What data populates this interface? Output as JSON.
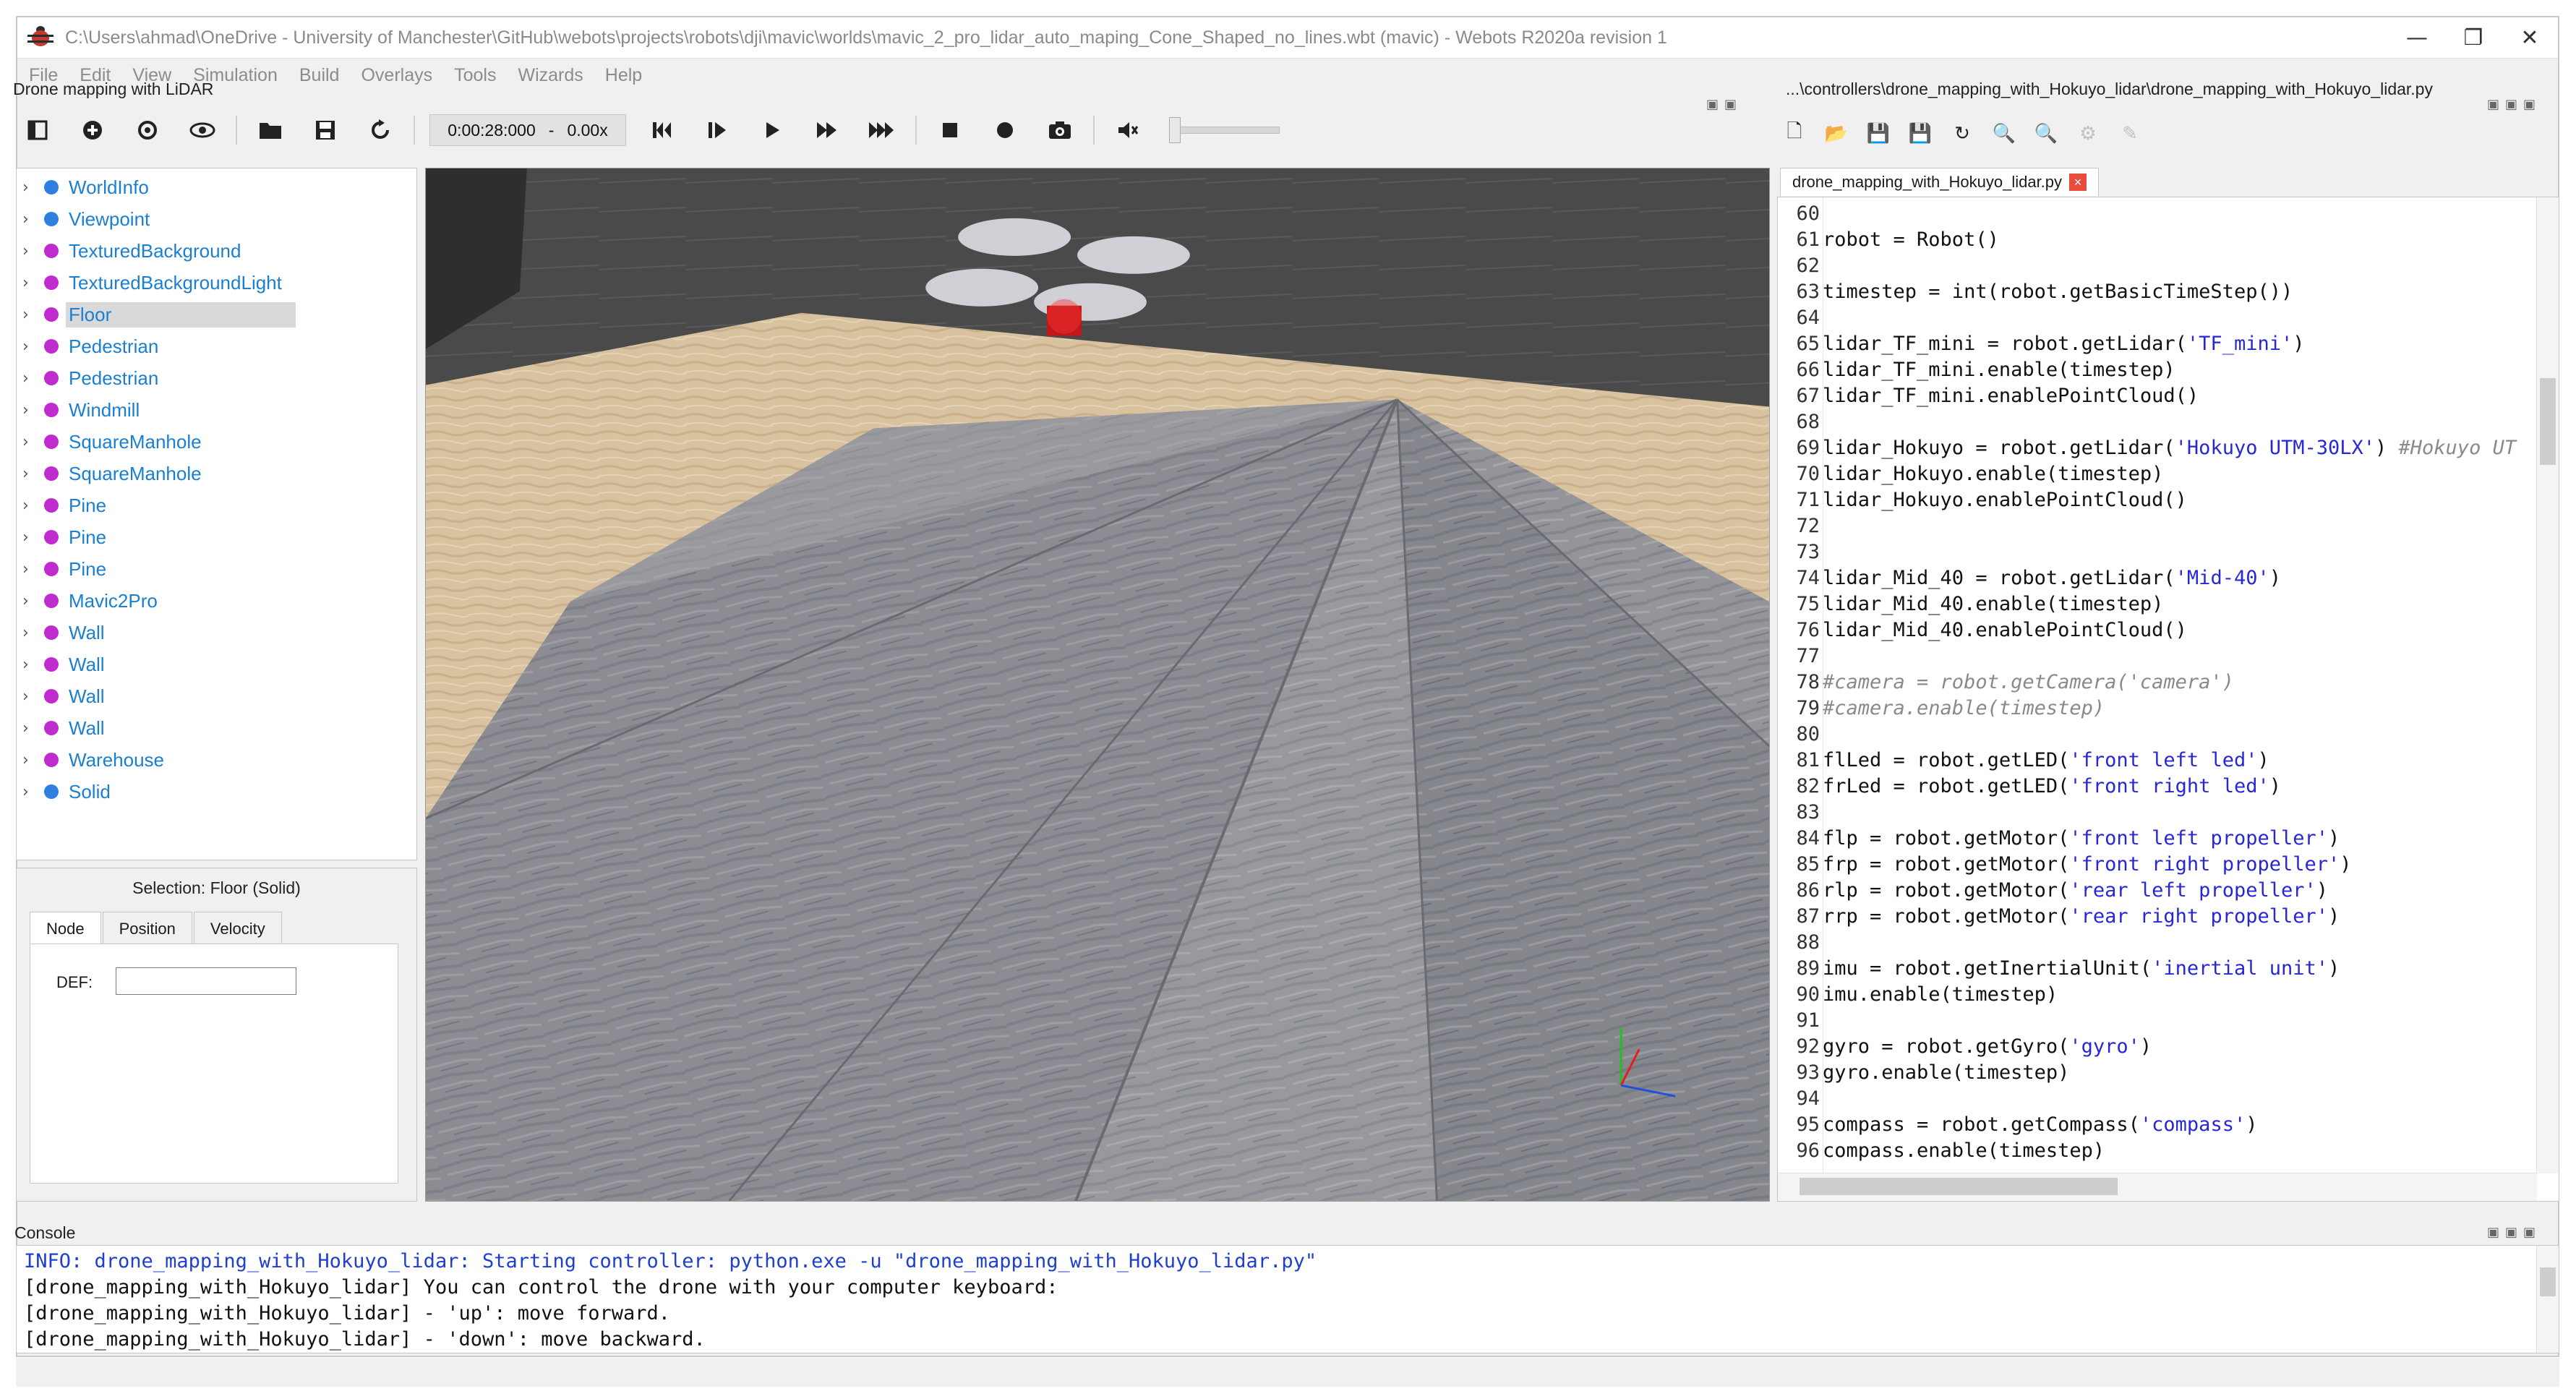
{
  "window": {
    "title": "C:\\Users\\ahmad\\OneDrive - University of Manchester\\GitHub\\webots\\projects\\robots\\dji\\mavic\\worlds\\mavic_2_pro_lidar_auto_maping_Cone_Shaped_no_lines.wbt (mavic) - Webots R2020a revision 1",
    "minimize_glyph": "—",
    "restore_glyph": "❐",
    "close_glyph": "✕"
  },
  "menu": [
    "File",
    "Edit",
    "View",
    "Simulation",
    "Build",
    "Overlays",
    "Tools",
    "Wizards",
    "Help"
  ],
  "simulation": {
    "panel_title": "Drone mapping with LiDAR",
    "time": "0:00:28:000",
    "separator": "-",
    "speed": "0.00x"
  },
  "toolbar_icons": [
    "sidebar-toggle-icon",
    "add-node-icon",
    "reset-view-icon",
    "visibility-icon",
    "open-world-icon",
    "save-world-icon",
    "reload-world-icon",
    "reset-simulation-icon",
    "step-icon",
    "play-icon",
    "fast-icon",
    "fastest-icon",
    "stop-recording-icon",
    "record-icon",
    "screenshot-icon",
    "sound-icon"
  ],
  "scene_tree": [
    {
      "label": "WorldInfo",
      "color": "#2f7fe0"
    },
    {
      "label": "Viewpoint",
      "color": "#2f7fe0"
    },
    {
      "label": "TexturedBackground",
      "color": "#c02bd0"
    },
    {
      "label": "TexturedBackgroundLight",
      "color": "#c02bd0"
    },
    {
      "label": "Floor",
      "color": "#c02bd0",
      "selected": true
    },
    {
      "label": "Pedestrian",
      "color": "#c02bd0"
    },
    {
      "label": "Pedestrian",
      "color": "#c02bd0"
    },
    {
      "label": "Windmill",
      "color": "#c02bd0"
    },
    {
      "label": "SquareManhole",
      "color": "#c02bd0"
    },
    {
      "label": "SquareManhole",
      "color": "#c02bd0"
    },
    {
      "label": "Pine",
      "color": "#c02bd0"
    },
    {
      "label": "Pine",
      "color": "#c02bd0"
    },
    {
      "label": "Pine",
      "color": "#c02bd0"
    },
    {
      "label": "Mavic2Pro",
      "color": "#c02bd0"
    },
    {
      "label": "Wall",
      "color": "#c02bd0"
    },
    {
      "label": "Wall",
      "color": "#c02bd0"
    },
    {
      "label": "Wall",
      "color": "#c02bd0"
    },
    {
      "label": "Wall",
      "color": "#c02bd0"
    },
    {
      "label": "Warehouse",
      "color": "#c02bd0"
    },
    {
      "label": "Solid",
      "color": "#2f7fe0"
    }
  ],
  "selection": {
    "title": "Selection: Floor (Solid)",
    "tabs": [
      "Node",
      "Position",
      "Velocity"
    ],
    "def_label": "DEF:",
    "def_value": ""
  },
  "editor": {
    "panel_title": "...\\controllers\\drone_mapping_with_Hokuyo_lidar\\drone_mapping_with_Hokuyo_lidar.py",
    "tab_label": "drone_mapping_with_Hokuyo_lidar.py",
    "tab_close": "×",
    "lines": [
      {
        "n": "60",
        "code": ""
      },
      {
        "n": "61",
        "code": "robot = Robot()"
      },
      {
        "n": "62",
        "code": ""
      },
      {
        "n": "63",
        "code": "timestep = int(robot.getBasicTimeStep())"
      },
      {
        "n": "64",
        "code": ""
      },
      {
        "n": "65",
        "code": "lidar_TF_mini = robot.getLidar('TF_mini')"
      },
      {
        "n": "66",
        "code": "lidar_TF_mini.enable(timestep)"
      },
      {
        "n": "67",
        "code": "lidar_TF_mini.enablePointCloud()"
      },
      {
        "n": "68",
        "code": ""
      },
      {
        "n": "69",
        "code": "lidar_Hokuyo = robot.getLidar('Hokuyo UTM-30LX') #Hokuyo UT"
      },
      {
        "n": "70",
        "code": "lidar_Hokuyo.enable(timestep)"
      },
      {
        "n": "71",
        "code": "lidar_Hokuyo.enablePointCloud()"
      },
      {
        "n": "72",
        "code": ""
      },
      {
        "n": "73",
        "code": ""
      },
      {
        "n": "74",
        "code": "lidar_Mid_40 = robot.getLidar('Mid-40')"
      },
      {
        "n": "75",
        "code": "lidar_Mid_40.enable(timestep)"
      },
      {
        "n": "76",
        "code": "lidar_Mid_40.enablePointCloud()"
      },
      {
        "n": "77",
        "code": ""
      },
      {
        "n": "78",
        "code": "#camera = robot.getCamera('camera')"
      },
      {
        "n": "79",
        "code": "#camera.enable(timestep)"
      },
      {
        "n": "80",
        "code": ""
      },
      {
        "n": "81",
        "code": "flLed = robot.getLED('front left led')"
      },
      {
        "n": "82",
        "code": "frLed = robot.getLED('front right led')"
      },
      {
        "n": "83",
        "code": ""
      },
      {
        "n": "84",
        "code": "flp = robot.getMotor('front left propeller')"
      },
      {
        "n": "85",
        "code": "frp = robot.getMotor('front right propeller')"
      },
      {
        "n": "86",
        "code": "rlp = robot.getMotor('rear left propeller')"
      },
      {
        "n": "87",
        "code": "rrp = robot.getMotor('rear right propeller')"
      },
      {
        "n": "88",
        "code": ""
      },
      {
        "n": "89",
        "code": "imu = robot.getInertialUnit('inertial unit')"
      },
      {
        "n": "90",
        "code": "imu.enable(timestep)"
      },
      {
        "n": "91",
        "code": ""
      },
      {
        "n": "92",
        "code": "gyro = robot.getGyro('gyro')"
      },
      {
        "n": "93",
        "code": "gyro.enable(timestep)"
      },
      {
        "n": "94",
        "code": ""
      },
      {
        "n": "95",
        "code": "compass = robot.getCompass('compass')"
      },
      {
        "n": "96",
        "code": "compass.enable(timestep)"
      }
    ]
  },
  "console": {
    "title": "Console",
    "lines": [
      {
        "text": "INFO: drone_mapping_with_Hokuyo_lidar: Starting controller: python.exe -u \"drone_mapping_with_Hokuyo_lidar.py\"",
        "kind": "info"
      },
      {
        "text": "[drone_mapping_with_Hokuyo_lidar] You can control the drone with your computer keyboard:",
        "kind": "normal"
      },
      {
        "text": "[drone_mapping_with_Hokuyo_lidar] - 'up': move forward.",
        "kind": "normal"
      },
      {
        "text": "[drone_mapping_with_Hokuyo_lidar] - 'down': move backward.",
        "kind": "normal"
      }
    ]
  },
  "colors": {
    "accent": "#1a7fd0",
    "string": "#2727d8",
    "comment": "#8a8a8a",
    "info": "#1f3fd1"
  }
}
